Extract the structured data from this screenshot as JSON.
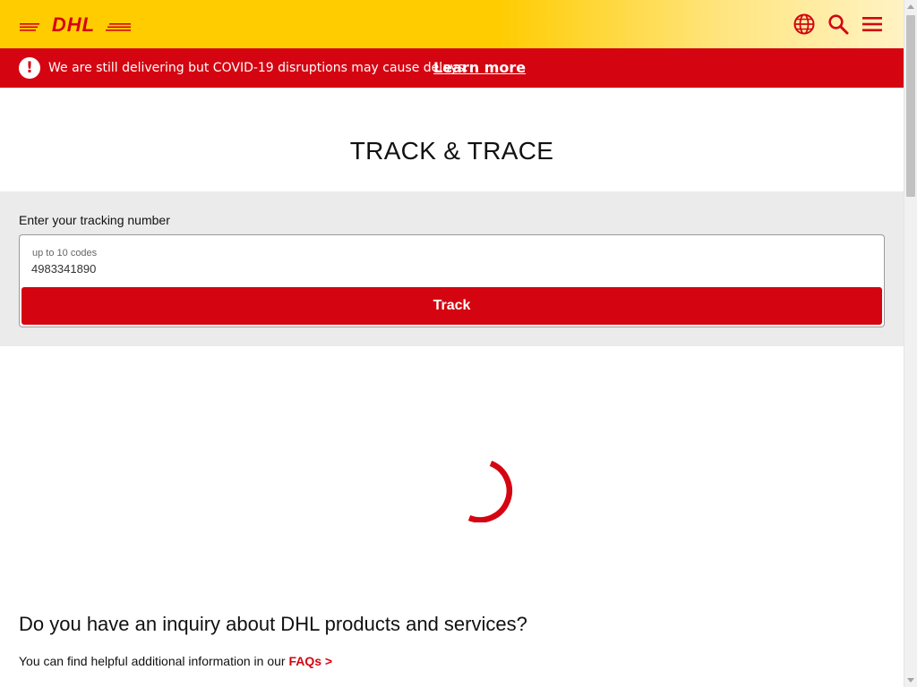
{
  "header": {
    "logo": "DHL",
    "brand_color": "#ffcc00",
    "icons": [
      "globe-icon",
      "search-icon",
      "menu-icon"
    ]
  },
  "alert": {
    "icon": "!",
    "message": "We are still delivering but COVID-19 disruptions may cause delays.",
    "link_label": "Learn more",
    "color": "#d40511"
  },
  "page": {
    "title": "TRACK & TRACE"
  },
  "tracking": {
    "label": "Enter your tracking number",
    "placeholder": "up to 10 codes",
    "value": "4983341890",
    "button_label": "Track"
  },
  "inquiry": {
    "title": "Do you have an inquiry about DHL products and services?",
    "text": "You can find helpful additional information in our",
    "link_label": "FAQs >"
  }
}
